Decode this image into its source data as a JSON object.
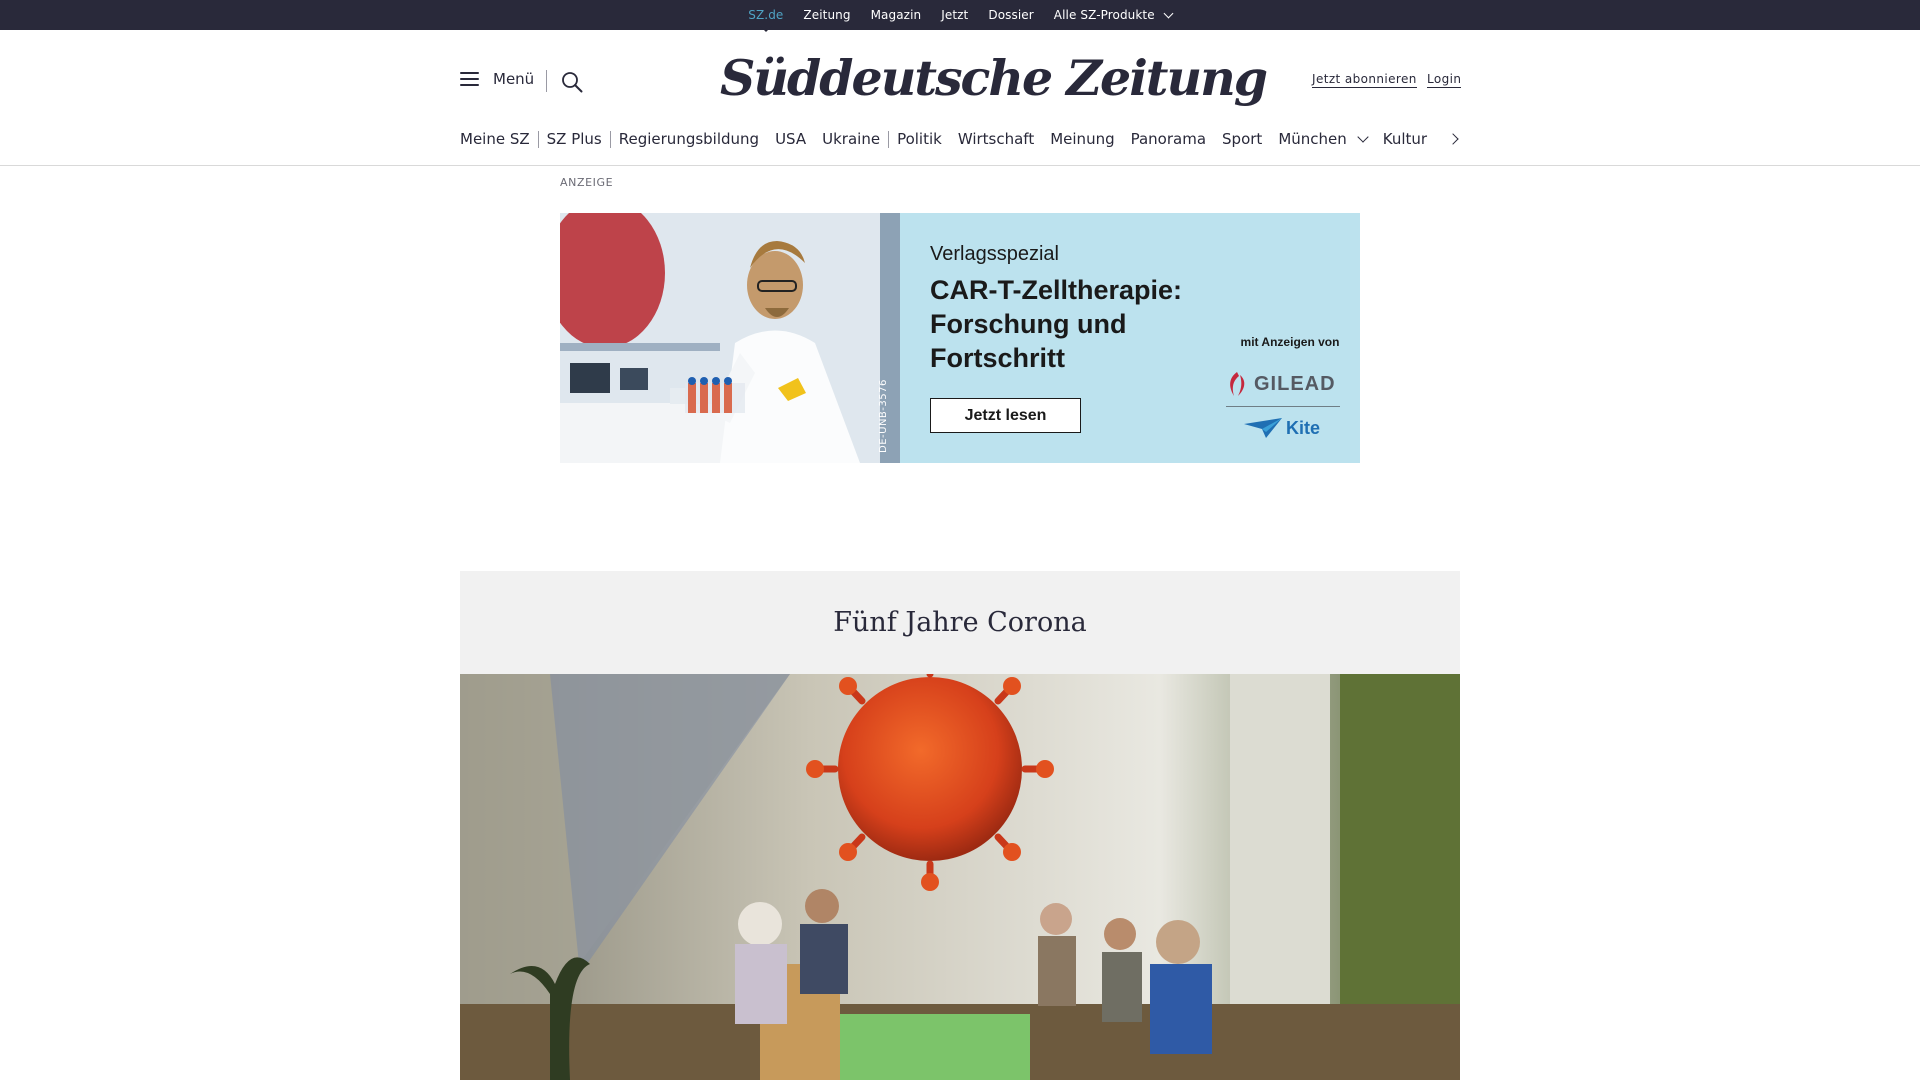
{
  "topbar": {
    "items": [
      {
        "label": "SZ.de",
        "active": true
      },
      {
        "label": "Zeitung"
      },
      {
        "label": "Magazin"
      },
      {
        "label": "Jetzt"
      },
      {
        "label": "Dossier"
      },
      {
        "label": "Alle SZ-Produkte",
        "has_dropdown": true
      }
    ]
  },
  "header": {
    "menu_label": "Menü",
    "logo_text": "Süddeutsche Zeitung",
    "subscribe_label": "Jetzt abonnieren",
    "login_label": "Login",
    "search_icon": "search-icon",
    "menu_icon": "hamburger-icon"
  },
  "ressorts": {
    "items": [
      {
        "label": "Meine SZ"
      },
      {
        "label": "SZ Plus"
      },
      {
        "label": "Regierungsbildung"
      },
      {
        "label": "USA"
      },
      {
        "label": "Ukraine"
      },
      {
        "label": "Politik"
      },
      {
        "label": "Wirtschaft"
      },
      {
        "label": "Meinung"
      },
      {
        "label": "Panorama"
      },
      {
        "label": "Sport"
      },
      {
        "label": "München",
        "has_dropdown": true
      },
      {
        "label": "Kultur"
      }
    ]
  },
  "ad": {
    "label": "ANZEIGE",
    "code": "DE-UNB-3576",
    "kicker": "Verlagsspezial",
    "headline": "CAR-T-Zelltherapie: Forschung und Fortschritt",
    "cta": "Jetzt lesen",
    "sponsor_note": "mit Anzeigen von",
    "sponsor_1": "GILEAD",
    "sponsor_2": "Kite"
  },
  "dossier": {
    "title": "Fünf Jahre Corona"
  },
  "colors": {
    "topbar_bg": "#29293a",
    "topbar_active": "#4fa3c4",
    "ad_bg": "#bce2ee",
    "dossier_bg": "#f1f1f1",
    "virus": "#e0441c"
  }
}
